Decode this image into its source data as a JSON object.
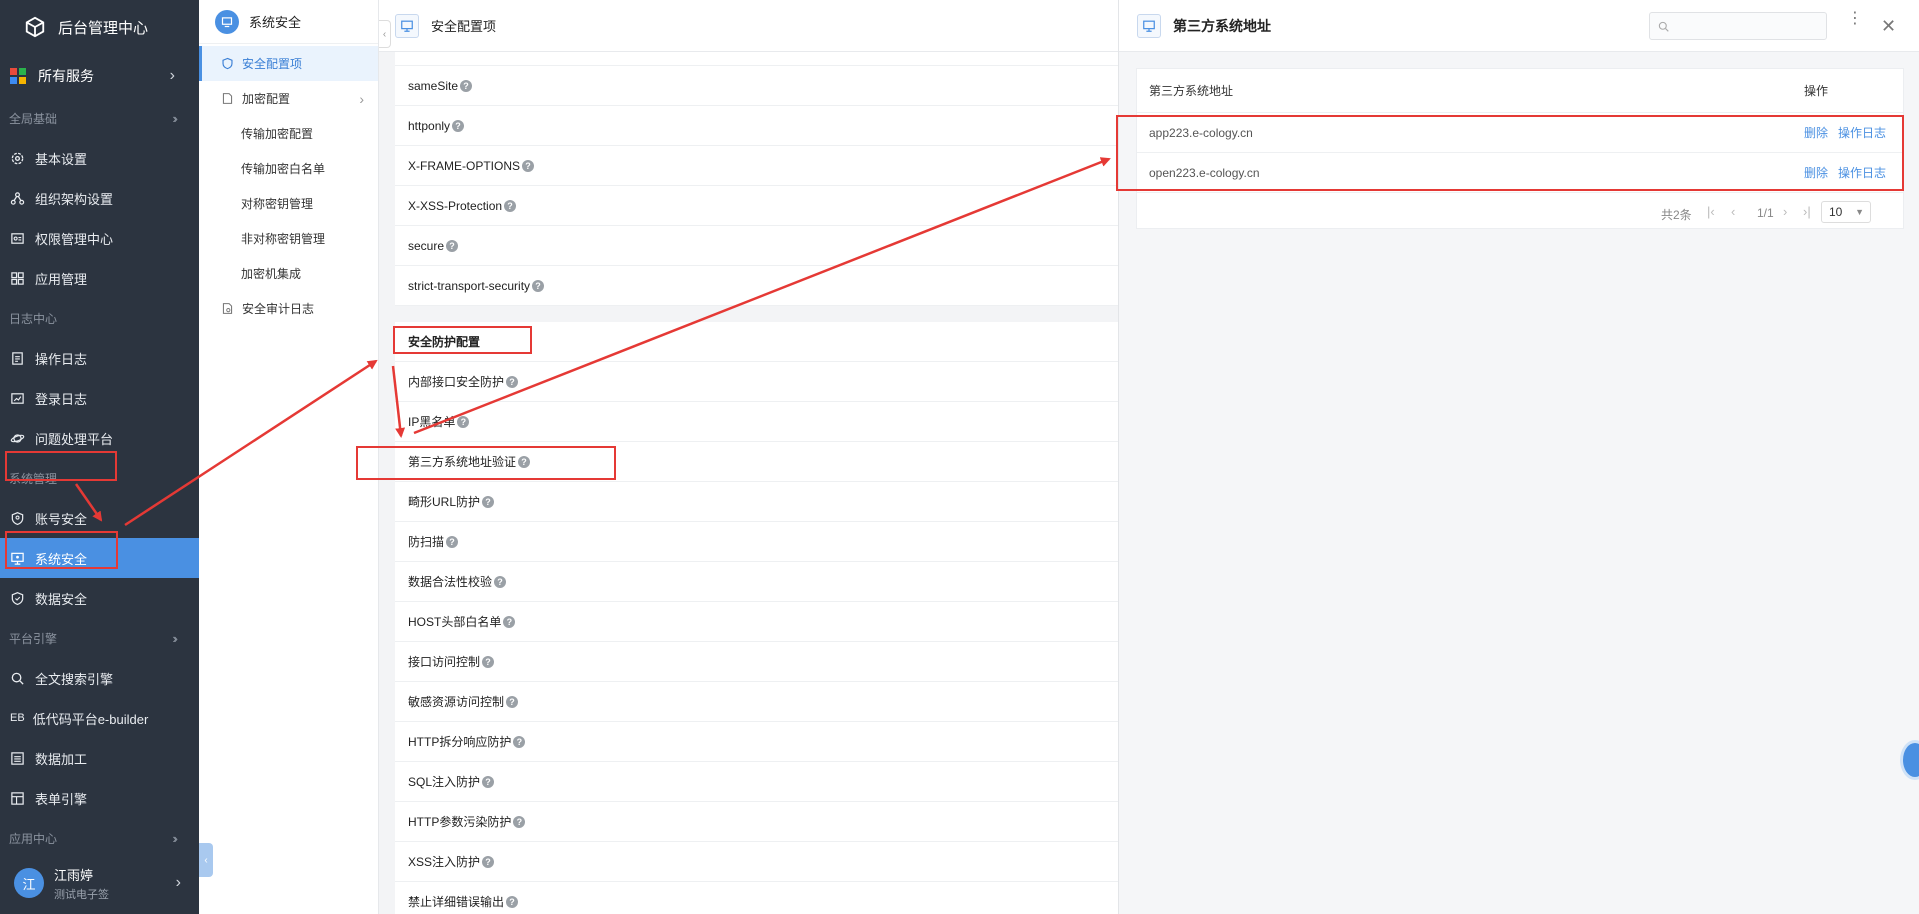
{
  "sidebar": {
    "brand": "后台管理中心",
    "all_services": "所有服务",
    "groups": {
      "global": "全局基础",
      "log": "日志中心",
      "system": "系统管理",
      "platform": "平台引擎",
      "app": "应用中心"
    },
    "items": {
      "basic": "基本设置",
      "org": "组织架构设置",
      "perm": "权限管理中心",
      "appmgmt": "应用管理",
      "oplog": "操作日志",
      "loginlog": "登录日志",
      "issue": "问题处理平台",
      "account": "账号安全",
      "syssec": "系统安全",
      "datasec": "数据安全",
      "search": "全文搜索引擎",
      "lowcode": "低代码平台e-builder",
      "lowcode_prefix": "EB",
      "dataproc": "数据加工",
      "form": "表单引擎"
    },
    "user": {
      "avatar": "江",
      "name": "江雨婷",
      "subtitle": "测试电子签"
    }
  },
  "submenu": {
    "title": "系统安全",
    "items": {
      "config": "安全配置项",
      "encrypt": "加密配置",
      "transfer": "传输加密配置",
      "whitelist": "传输加密白名单",
      "symmetric": "对称密钥管理",
      "asymmetric": "非对称密钥管理",
      "machine": "加密机集成",
      "audit": "安全审计日志"
    }
  },
  "main": {
    "title": "安全配置项",
    "rows1": [
      "sameSite",
      "httponly",
      "X-FRAME-OPTIONS",
      "X-XSS-Protection",
      "secure",
      "strict-transport-security"
    ],
    "section2": "安全防护配置",
    "rows2": [
      "内部接口安全防护",
      "IP黑名单",
      "第三方系统地址验证",
      "畸形URL防护",
      "防扫描",
      "数据合法性校验",
      "HOST头部白名单",
      "接口访问控制",
      "敏感资源访问控制",
      "HTTP拆分响应防护",
      "SQL注入防护",
      "HTTP参数污染防护",
      "XSS注入防护",
      "禁止详细错误输出"
    ]
  },
  "drawer": {
    "title": "第三方系统地址",
    "search_placeholder": "",
    "table": {
      "col_address": "第三方系统地址",
      "col_action": "操作",
      "rows": [
        {
          "address": "app223.e-cology.cn",
          "delete": "删除",
          "log": "操作日志"
        },
        {
          "address": "open223.e-cology.cn",
          "delete": "删除",
          "log": "操作日志"
        }
      ]
    },
    "pager": {
      "total": "共2条",
      "page": "1/1",
      "size": "10"
    }
  },
  "colors": {
    "accent": "#4a90e2",
    "sidebar_bg": "#2c3440",
    "annotation": "#e53935"
  }
}
